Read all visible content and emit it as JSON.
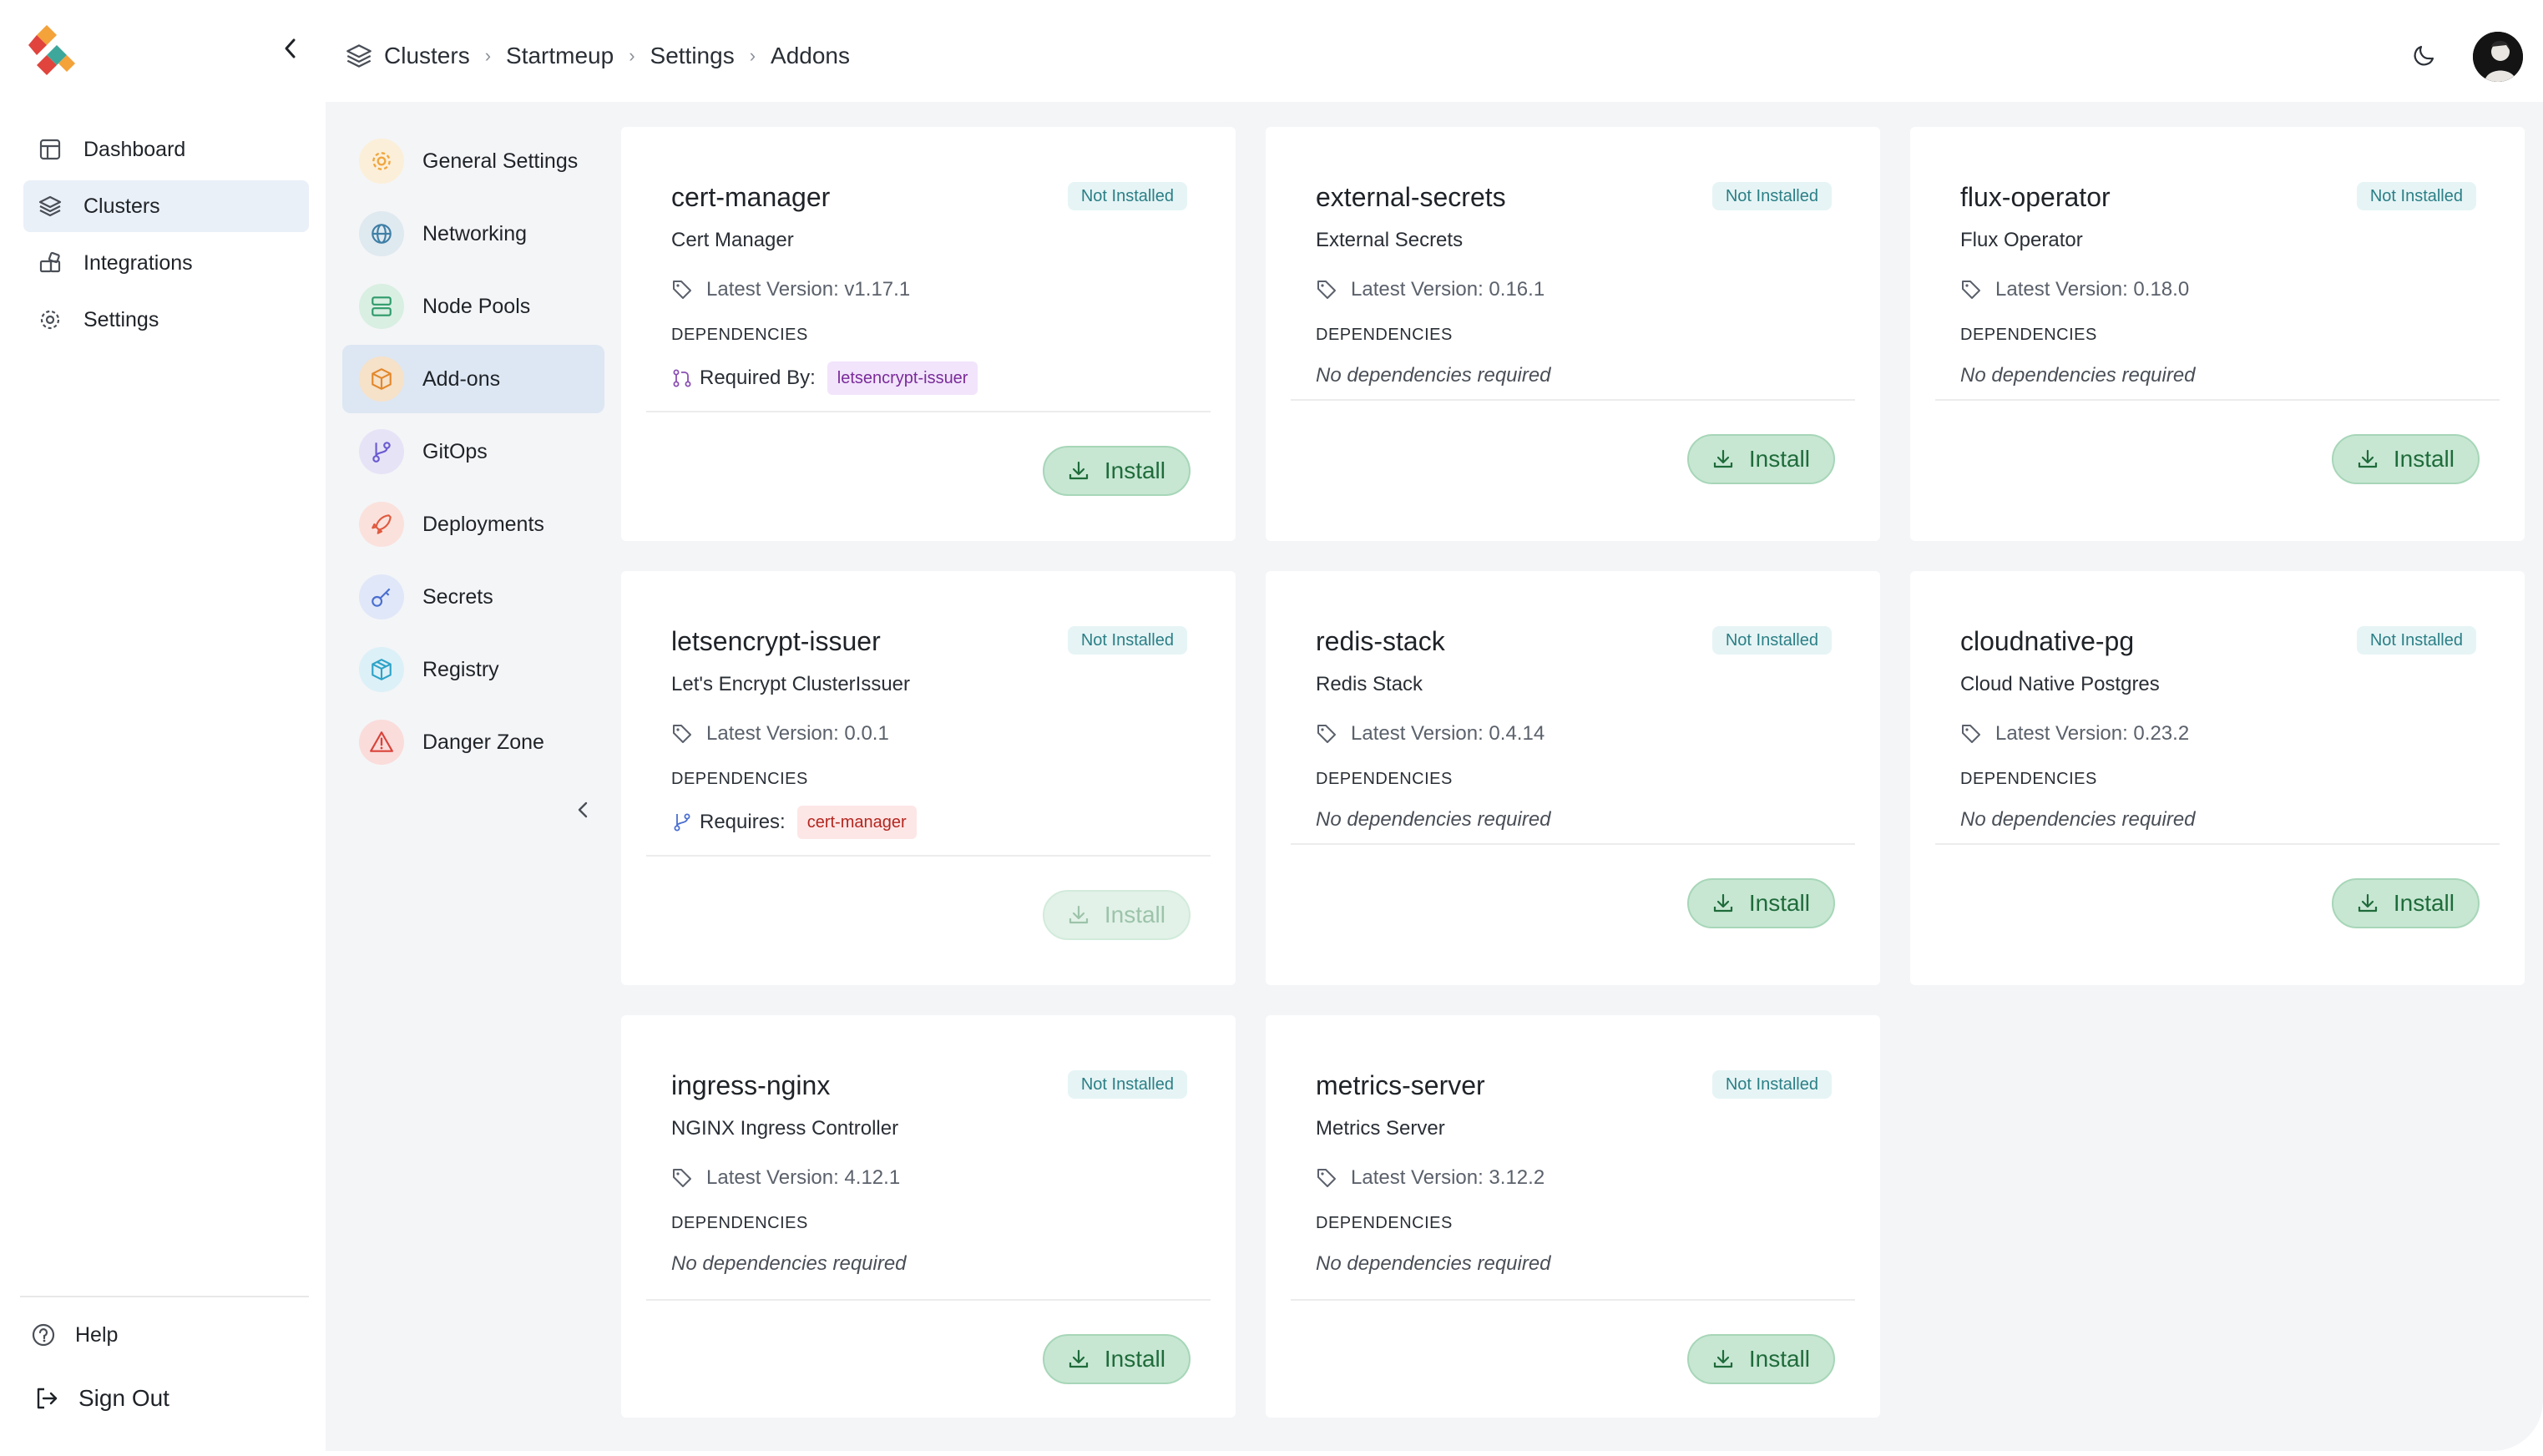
{
  "sidebar": {
    "items": [
      {
        "label": "Dashboard",
        "icon": "dashboard-icon"
      },
      {
        "label": "Clusters",
        "icon": "layers-icon",
        "active": true
      },
      {
        "label": "Integrations",
        "icon": "integrations-icon"
      },
      {
        "label": "Settings",
        "icon": "gear-icon"
      }
    ],
    "help_label": "Help",
    "signout_label": "Sign Out"
  },
  "breadcrumb": [
    "Clusters",
    "Startmeup",
    "Settings",
    "Addons"
  ],
  "subnav": {
    "items": [
      {
        "label": "General Settings",
        "icon": "gear-icon",
        "color": "#f0a640"
      },
      {
        "label": "Networking",
        "icon": "globe-icon",
        "color": "#3f7fa6"
      },
      {
        "label": "Node Pools",
        "icon": "server-icon",
        "color": "#2f9a6a"
      },
      {
        "label": "Add-ons",
        "icon": "box-icon",
        "color": "#e2882b",
        "active": true
      },
      {
        "label": "GitOps",
        "icon": "git-branch-icon",
        "color": "#6a5bd0"
      },
      {
        "label": "Deployments",
        "icon": "rocket-icon",
        "color": "#e05a3f"
      },
      {
        "label": "Secrets",
        "icon": "key-icon",
        "color": "#4a6fd0"
      },
      {
        "label": "Registry",
        "icon": "package-icon",
        "color": "#2ea3c7"
      },
      {
        "label": "Danger Zone",
        "icon": "warning-icon",
        "color": "#d9433a"
      }
    ]
  },
  "addons": {
    "status_label": "Not Installed",
    "version_prefix": "Latest Version: ",
    "dependencies_title": "DEPENDENCIES",
    "no_deps_label": "No dependencies required",
    "install_label": "Install",
    "cards": [
      {
        "name": "cert-manager",
        "desc": "Cert Manager",
        "version": "Latest Version: v1.17.1",
        "dep_label": "Required By:",
        "dep_chip": "letsencrypt-issuer",
        "dep_kind": "required-by"
      },
      {
        "name": "external-secrets",
        "desc": "External Secrets",
        "version": "Latest Version: 0.16.1"
      },
      {
        "name": "flux-operator",
        "desc": "Flux Operator",
        "version": "Latest Version: 0.18.0"
      },
      {
        "name": "letsencrypt-issuer",
        "desc": "Let's Encrypt ClusterIssuer",
        "version": "Latest Version: 0.0.1",
        "dep_label": "Requires:",
        "dep_chip": "cert-manager",
        "dep_kind": "requires",
        "install_disabled": true
      },
      {
        "name": "redis-stack",
        "desc": "Redis Stack",
        "version": "Latest Version: 0.4.14"
      },
      {
        "name": "cloudnative-pg",
        "desc": "Cloud Native Postgres",
        "version": "Latest Version: 0.23.2"
      },
      {
        "name": "ingress-nginx",
        "desc": "NGINX Ingress Controller",
        "version": "Latest Version: 4.12.1"
      },
      {
        "name": "metrics-server",
        "desc": "Metrics Server",
        "version": "Latest Version: 3.12.2"
      }
    ]
  }
}
